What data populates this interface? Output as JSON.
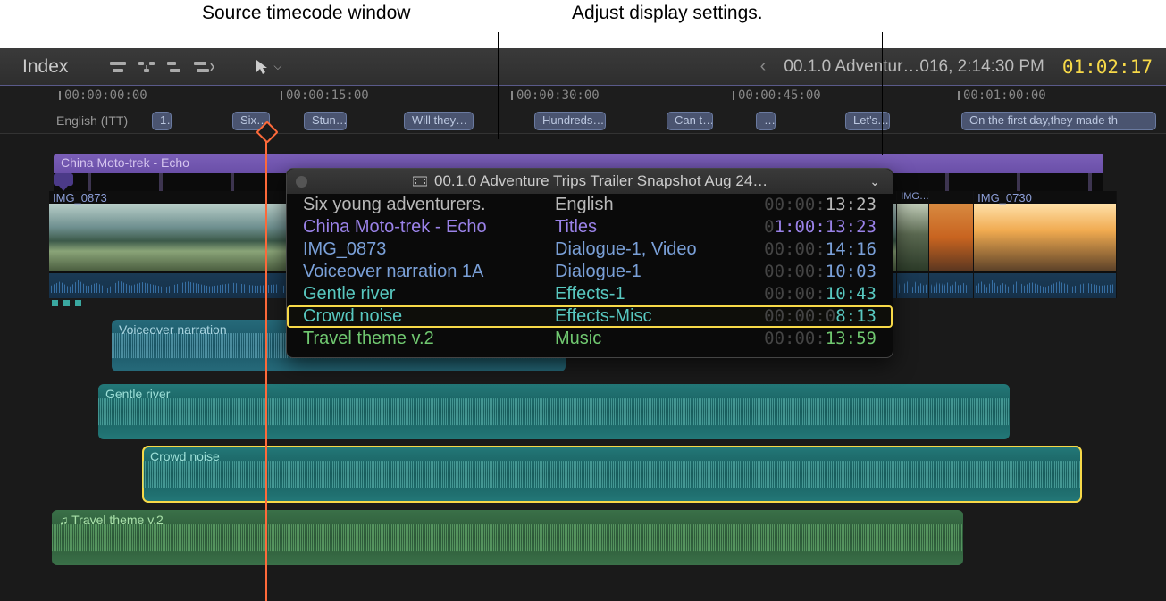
{
  "annotations": {
    "left": "Source timecode window",
    "right": "Adjust display settings."
  },
  "toolbar": {
    "index": "Index",
    "project_prefix": "‹",
    "project_title": "00.1.0 Adventur…016, 2:14:30 PM",
    "master_timecode": "01:02:17"
  },
  "ruler": {
    "ticks": [
      "00:00:00:00",
      "00:00:15:00",
      "00:00:30:00",
      "00:00:45:00",
      "00:01:00:00"
    ],
    "caption_lang": "English (ITT)",
    "captions": [
      "1…",
      "Six…",
      "Stun…",
      "Will they…",
      "Hundreds…",
      "Can t…",
      "…",
      "Let's…",
      "On the first day,they made th"
    ]
  },
  "tracks": {
    "title_clip": "China Moto-trek - Echo",
    "video_clips": [
      "IMG_0873",
      "IMG…",
      "IMG_0730"
    ],
    "voiceover": "Voiceover narration",
    "gentle_river": "Gentle river",
    "crowd_noise": "Crowd noise",
    "travel_theme": "Travel theme v.2"
  },
  "timecode_window": {
    "title": "00.1.0 Adventure Trips Trailer Snapshot Aug 24…",
    "rows": [
      {
        "name": "Six young adventurers.",
        "role": "English",
        "tc_dim": "00:00:",
        "tc": "13:23",
        "color": "caption"
      },
      {
        "name": "China Moto-trek - Echo",
        "role": "Titles",
        "tc_dim": "0",
        "tc": "1:00:13:23",
        "color": "titles"
      },
      {
        "name": "IMG_0873",
        "role": "Dialogue-1, Video",
        "tc_dim": "00:00:",
        "tc": "14:16",
        "color": "video"
      },
      {
        "name": "Voiceover narration 1A",
        "role": "Dialogue-1",
        "tc_dim": "00:00:",
        "tc": "10:03",
        "color": "dialogue"
      },
      {
        "name": "Gentle river",
        "role": "Effects-1",
        "tc_dim": "00:00:",
        "tc": "10:43",
        "color": "effects"
      },
      {
        "name": "Crowd noise",
        "role": "Effects-Misc",
        "tc_dim": "00:00:0",
        "tc": "8:13",
        "color": "effects",
        "highlight": true
      },
      {
        "name": "Travel theme v.2",
        "role": "Music",
        "tc_dim": "00:00:",
        "tc": "13:59",
        "color": "music"
      }
    ]
  },
  "colors": {
    "accent": "#f7d948",
    "playhead": "#ff6a3a"
  }
}
